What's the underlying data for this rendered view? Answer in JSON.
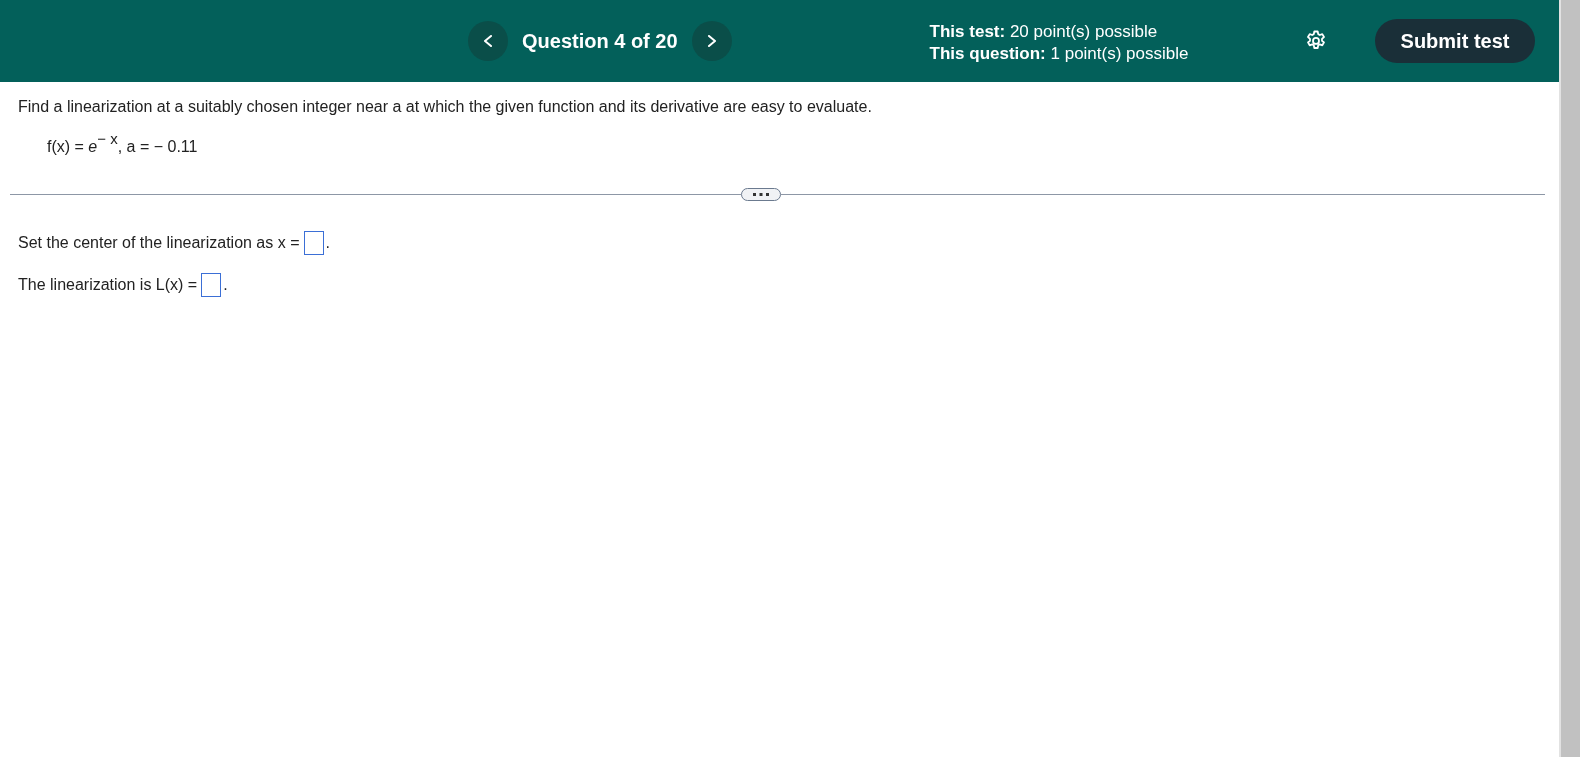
{
  "header": {
    "question_label": "Question 4 of 20",
    "points": [
      {
        "label": "This test:",
        "value": "20 point(s) possible"
      },
      {
        "label": "This question:",
        "value": "1 point(s) possible"
      }
    ],
    "submit_button": "Submit test"
  },
  "question": {
    "prompt": "Find a linearization at a suitably chosen integer near a at which the given function and its derivative are easy to evaluate.",
    "formula": "f(x) = *e*$^{− x}$, a = − 0.11"
  },
  "answers": [
    {
      "label": "Set the center of the linearization as x =",
      "suffix": "."
    },
    {
      "label": "The linearization is L(x) =",
      "suffix": "."
    }
  ]
}
